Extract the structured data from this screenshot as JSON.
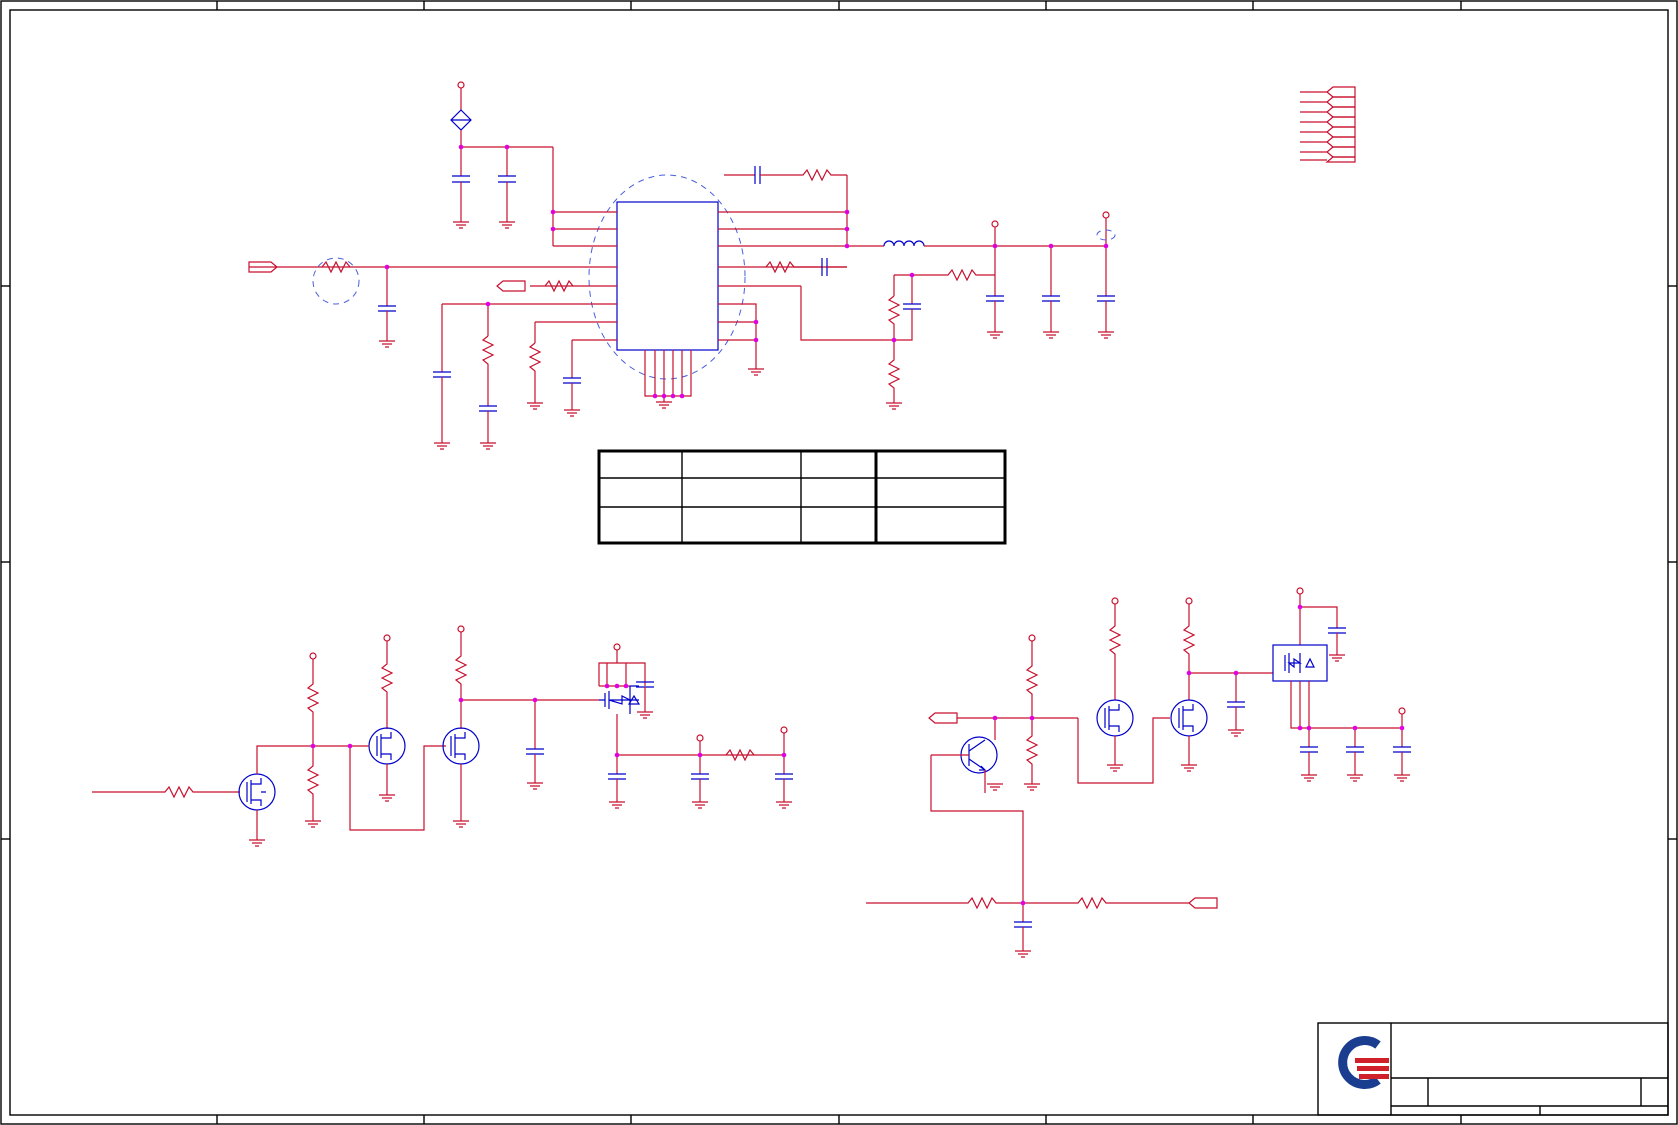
{
  "sheet": {
    "border_color": "#000000",
    "wire_color": "#c8102e",
    "component_color": "#0000cc",
    "junction_color": "#e000e0",
    "net_class_color": "#4a5fdc"
  },
  "revision_table": {
    "columns": 4,
    "rows": [
      [
        "",
        "",
        "",
        ""
      ],
      [
        "",
        "",
        "",
        ""
      ],
      [
        "",
        "",
        "",
        ""
      ]
    ]
  },
  "title_block": {
    "logo": "quanta-logo",
    "logo_colors": {
      "primary": "#1a3d8f",
      "accent": "#d0202a"
    },
    "title": "",
    "size": "",
    "document_number": "",
    "rev": ""
  }
}
